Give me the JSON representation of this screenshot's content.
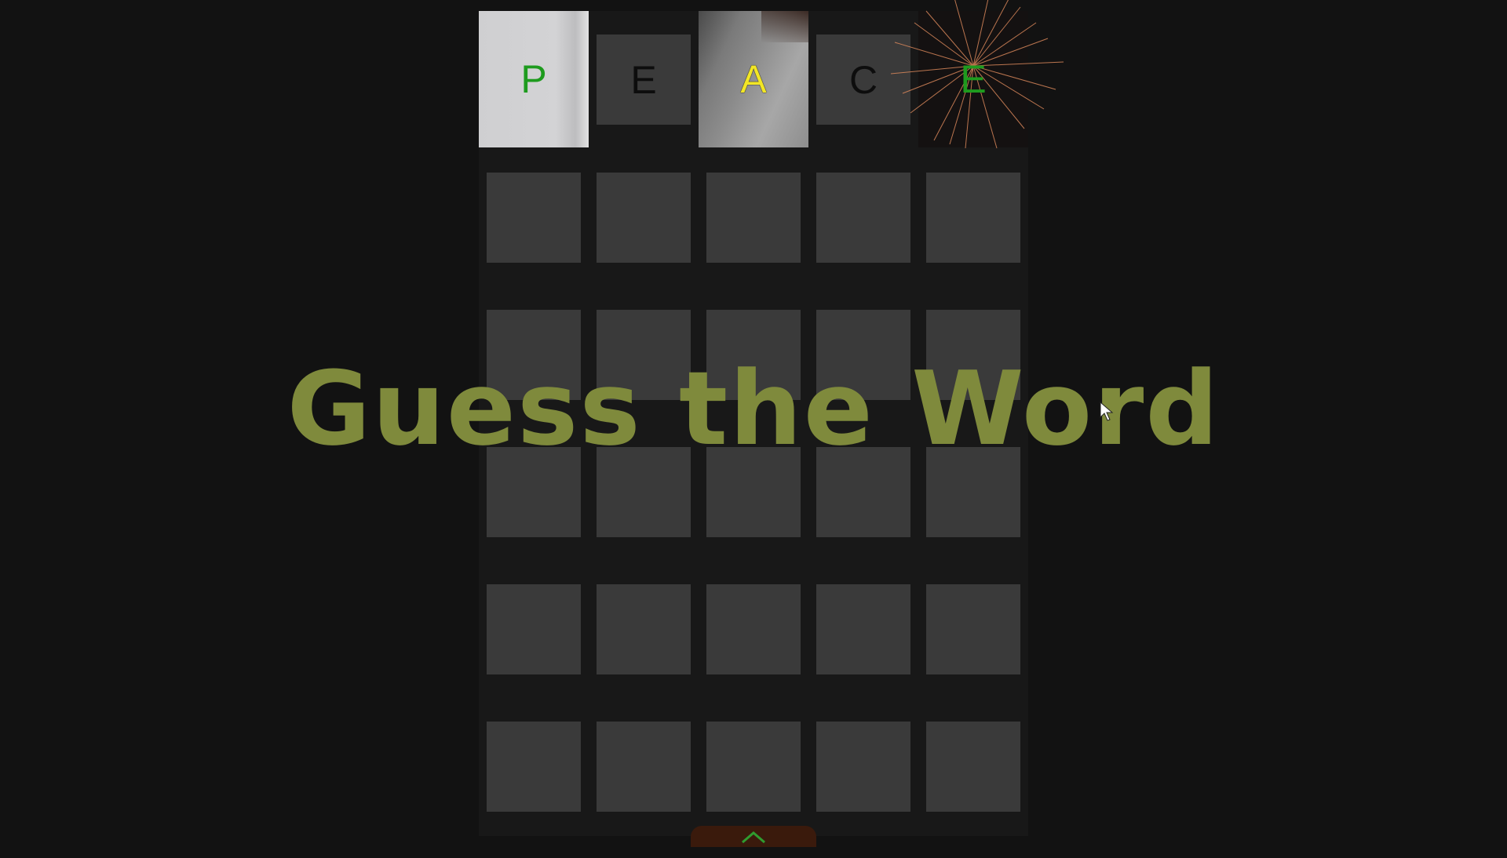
{
  "title": "Guess the Word",
  "board": {
    "guess_row": [
      {
        "letter": "P",
        "state": "correct",
        "color": "#1e9b1e"
      },
      {
        "letter": "E",
        "state": "absent",
        "color": "#0d0d0d"
      },
      {
        "letter": "A",
        "state": "present",
        "color": "#f2e626"
      },
      {
        "letter": "C",
        "state": "absent",
        "color": "#0d0d0d"
      },
      {
        "letter": "E",
        "state": "correct",
        "color": "#1e9b1e"
      }
    ],
    "rows": 6,
    "columns": 5
  },
  "controls": {
    "expand_icon": "chevron-up-icon"
  },
  "colors": {
    "background": "#121212",
    "tile_empty": "#3a3a3a",
    "title": "#7f8a3c",
    "correct": "#1e9b1e",
    "present": "#f2e626",
    "button": "#3a1a0c"
  }
}
